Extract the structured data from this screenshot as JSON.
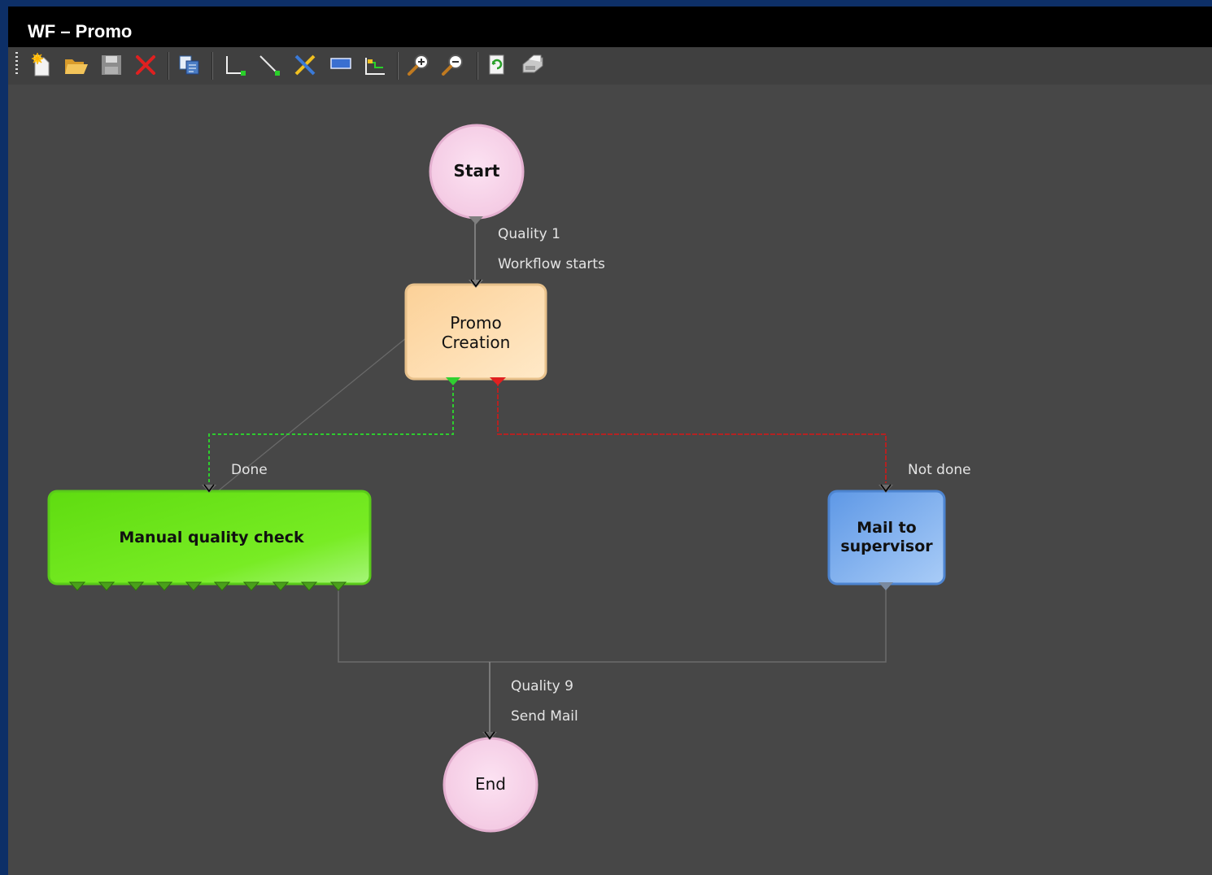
{
  "window": {
    "title": "WF – Promo"
  },
  "toolbar": {
    "buttons": [
      {
        "icon": "new-icon",
        "action": "new"
      },
      {
        "icon": "open-folder-icon",
        "action": "open"
      },
      {
        "icon": "save-icon",
        "action": "save"
      },
      {
        "icon": "delete-icon",
        "action": "delete"
      },
      {
        "icon": "copy-icon",
        "action": "copy"
      },
      {
        "icon": "elbow-connector-icon",
        "action": "elbow-connector"
      },
      {
        "icon": "straight-connector-icon",
        "action": "straight-connector"
      },
      {
        "icon": "tools-icon",
        "action": "tools"
      },
      {
        "icon": "rectangle-icon",
        "action": "rectangle"
      },
      {
        "icon": "layout-icon",
        "action": "layout"
      },
      {
        "icon": "zoom-in-icon",
        "action": "zoom-in"
      },
      {
        "icon": "zoom-out-icon",
        "action": "zoom-out"
      },
      {
        "icon": "refresh-icon",
        "action": "refresh"
      },
      {
        "icon": "print-icon",
        "action": "print"
      }
    ]
  },
  "diagram": {
    "nodes": {
      "start": {
        "label": "Start",
        "fill": "#f9d5ec"
      },
      "promo": {
        "label_line1": "Promo",
        "label_line2": "Creation",
        "fill": "#fcd9a6"
      },
      "manual": {
        "label": "Manual quality check",
        "fill": "#6ee81c"
      },
      "mail": {
        "label_line1": "Mail to",
        "label_line2": "supervisor",
        "fill": "#6fa6ec"
      },
      "end": {
        "label": "End",
        "fill": "#f9d5ec"
      }
    },
    "edges": {
      "start_promo": {
        "line1": "Quality  1",
        "line2": "Workflow starts"
      },
      "promo_manual": {
        "label": "Done",
        "color": "#2ecc2e"
      },
      "promo_mail": {
        "label": "Not done",
        "color": "#c02020"
      },
      "to_end": {
        "line1": "Quality  9",
        "line2": "Send Mail"
      }
    }
  }
}
